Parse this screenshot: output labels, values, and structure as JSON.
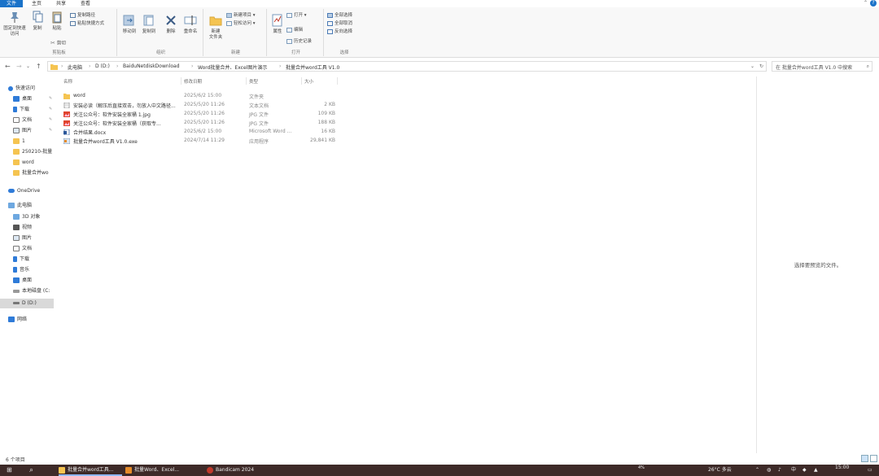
{
  "ribbon_tabs": [
    "文件",
    "主页",
    "共享",
    "查看"
  ],
  "ribbon": {
    "clipboard": {
      "pin_label": "固定到快速访问",
      "copy": "复制",
      "paste": "粘贴",
      "cut": "剪切",
      "copy_path": "复制路径",
      "paste_shortcut": "粘贴快捷方式",
      "group": "剪贴板"
    },
    "organize": {
      "move_to": "移动到",
      "copy_to": "复制到",
      "delete": "删除",
      "rename": "重命名",
      "group": "组织"
    },
    "new": {
      "new_folder": "新建\n文件夹",
      "new_item": "新建项目",
      "easy_access": "轻松访问",
      "group": "新建"
    },
    "open": {
      "properties": "属性",
      "open": "打开",
      "edit": "编辑",
      "history": "历史记录",
      "group": "打开"
    },
    "select": {
      "select_all": "全部选择",
      "select_none": "全部取消",
      "invert": "反向选择",
      "group": "选择"
    }
  },
  "address": {
    "breadcrumbs": [
      "此电脑",
      "D (D:)",
      "BaiduNetdiskDownload",
      "Word批量合并、Excel图片演示",
      "批量合并word工具 V1.0"
    ],
    "search_placeholder": "在 批量合并word工具 V1.0 中搜索"
  },
  "nav_pane": {
    "quick_access": "快速访问",
    "items": [
      "桌面",
      "下载",
      "文档",
      "图片",
      "1",
      "250210-批量",
      "word",
      "批量合并wo"
    ],
    "onedrive": "OneDrive",
    "this_pc": "此电脑",
    "pc_items": [
      "3D 对象",
      "视频",
      "图片",
      "文档",
      "下载",
      "音乐",
      "桌面",
      "本地磁盘 (C:",
      "D (D:)"
    ],
    "network": "网络"
  },
  "file_list": {
    "columns": [
      "名称",
      "修改日期",
      "类型",
      "大小"
    ],
    "rows": [
      {
        "name": "word",
        "date": "2025/6/2 15:00",
        "type": "文件夹",
        "size": ""
      },
      {
        "name": "安装必读（解压后直接双击，勿放入中文路径...",
        "date": "2025/5/20 11:26",
        "type": "文本文档",
        "size": "2 KB"
      },
      {
        "name": "关注公众号：软件安装全家桶 1.jpg",
        "date": "2025/5/20 11:26",
        "type": "JPG 文件",
        "size": "109 KB"
      },
      {
        "name": "关注公众号：软件安装全家桶（获取专...",
        "date": "2025/5/20 11:26",
        "type": "JPG 文件",
        "size": "188 KB"
      },
      {
        "name": "合并结果.docx",
        "date": "2025/6/2 15:00",
        "type": "Microsoft Word ...",
        "size": "16 KB"
      },
      {
        "name": "批量合并word工具 V1.0.exe",
        "date": "2024/7/14 11:29",
        "type": "应用程序",
        "size": "29,841 KB"
      }
    ]
  },
  "preview": {
    "message": "选择要预览的文件。"
  },
  "status": {
    "item_count": "6 个项目"
  },
  "taskbar": {
    "items": [
      "批量合并word工具...",
      "批量Word、Excel...",
      "Bandicam 2024"
    ],
    "weather": "26°C 多云",
    "percent": "4%",
    "ime": "中",
    "clock": "15:00"
  }
}
